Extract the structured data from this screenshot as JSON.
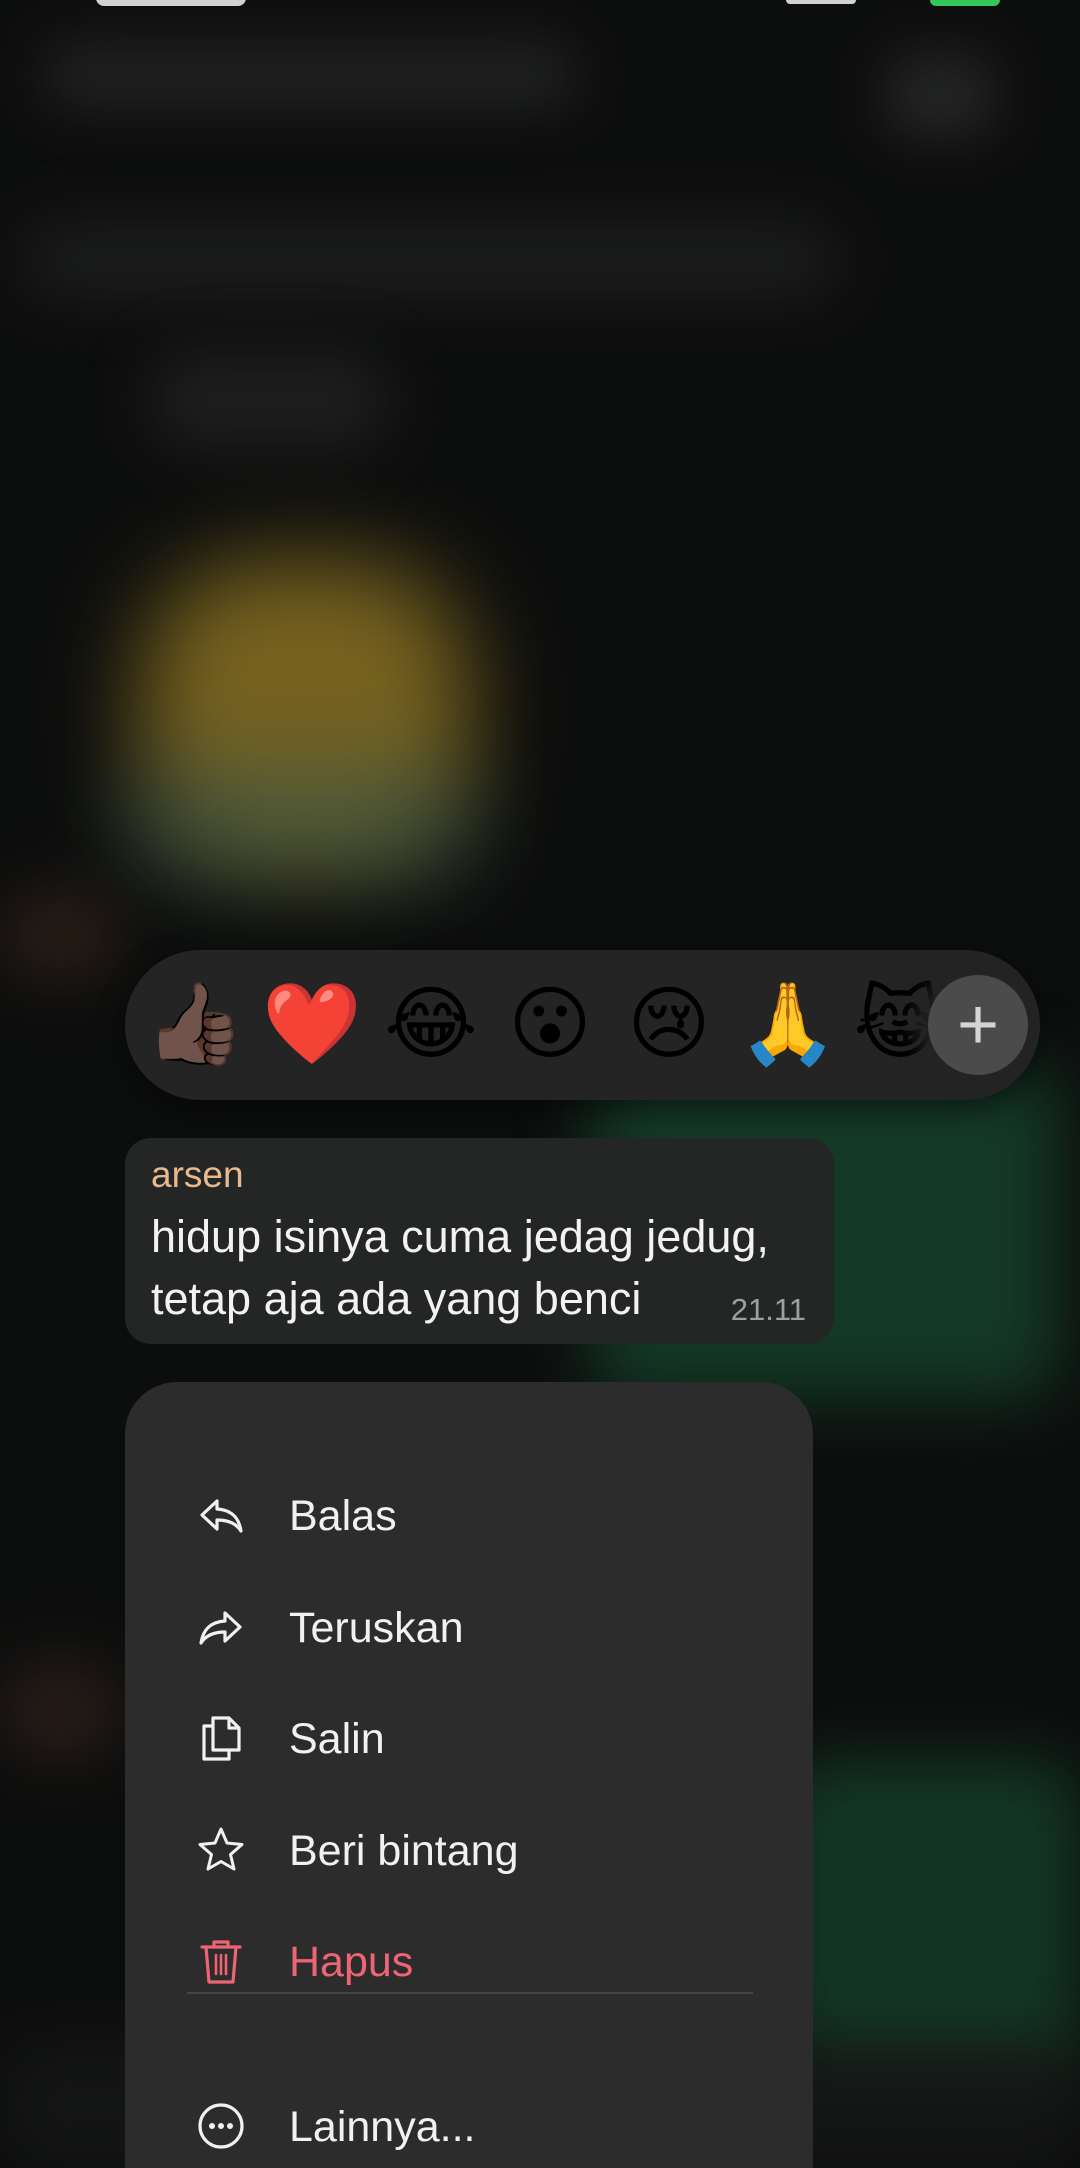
{
  "reactions": {
    "emojis": [
      "👍🏿",
      "❤️",
      "😂",
      "😮",
      "😢",
      "🙏",
      "😹"
    ],
    "more_label": "+"
  },
  "message": {
    "sender": "arsen",
    "text_line1": "hidup isinya cuma jedag jedug,",
    "text_line2": "tetap aja ada yang benci",
    "time": "21.11"
  },
  "menu": {
    "items": [
      {
        "label": "Balas",
        "icon": "reply-icon"
      },
      {
        "label": "Teruskan",
        "icon": "forward-icon"
      },
      {
        "label": "Salin",
        "icon": "copy-icon"
      },
      {
        "label": "Beri bintang",
        "icon": "star-icon"
      },
      {
        "label": "Hapus",
        "icon": "trash-icon",
        "color": "#ee6475"
      },
      {
        "label": "Lainnya...",
        "icon": "more-icon"
      }
    ]
  },
  "colors": {
    "sender": "#e9b98c",
    "danger": "#ee6475",
    "menu_bg": "#2b2c2b",
    "bubble_bg": "#242625"
  }
}
